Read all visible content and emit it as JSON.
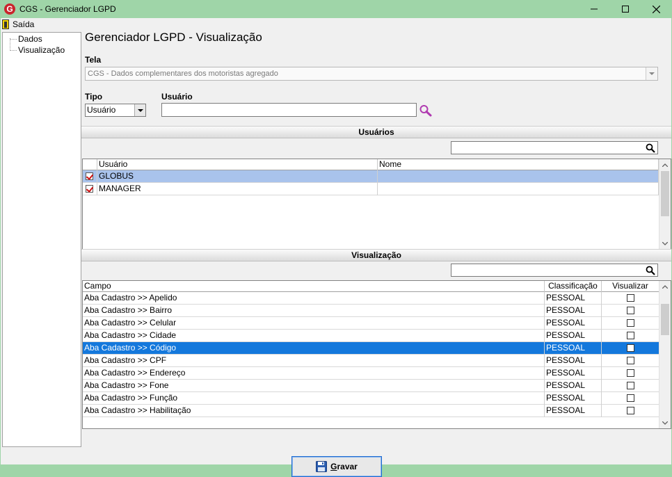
{
  "window": {
    "app_icon_letter": "G",
    "title": "CGS - Gerenciador LGPD"
  },
  "menu": {
    "exit_label": "Saída"
  },
  "tree": {
    "items": [
      {
        "label": "Dados"
      },
      {
        "label": "Visualização"
      }
    ]
  },
  "page": {
    "title": "Gerenciador LGPD - Visualização"
  },
  "form": {
    "tela_label": "Tela",
    "tela_value": "CGS - Dados complementares dos motoristas agregado",
    "tipo_label": "Tipo",
    "tipo_value": "Usuário",
    "usuario_label": "Usuário",
    "usuario_value": ""
  },
  "users_section": {
    "header": "Usuários",
    "filter_value": "",
    "columns": [
      "Usuário",
      "Nome"
    ],
    "rows": [
      {
        "checked": true,
        "usuario": "GLOBUS",
        "nome": ""
      },
      {
        "checked": true,
        "usuario": "MANAGER",
        "nome": ""
      }
    ]
  },
  "view_section": {
    "header": "Visualização",
    "filter_value": "",
    "columns": [
      "Campo",
      "Classificação",
      "Visualizar"
    ],
    "rows": [
      {
        "campo": "Aba Cadastro >> Apelido",
        "classificacao": "PESSOAL",
        "visualizar": false
      },
      {
        "campo": "Aba Cadastro >> Bairro",
        "classificacao": "PESSOAL",
        "visualizar": false
      },
      {
        "campo": "Aba Cadastro >> Celular",
        "classificacao": "PESSOAL",
        "visualizar": false
      },
      {
        "campo": "Aba Cadastro >> Cidade",
        "classificacao": "PESSOAL",
        "visualizar": false
      },
      {
        "campo": "Aba Cadastro >> Código",
        "classificacao": "PESSOAL",
        "visualizar": false
      },
      {
        "campo": "Aba Cadastro >> CPF",
        "classificacao": "PESSOAL",
        "visualizar": false
      },
      {
        "campo": "Aba Cadastro >> Endereço",
        "classificacao": "PESSOAL",
        "visualizar": false
      },
      {
        "campo": "Aba Cadastro >> Fone",
        "classificacao": "PESSOAL",
        "visualizar": false
      },
      {
        "campo": "Aba Cadastro >> Função",
        "classificacao": "PESSOAL",
        "visualizar": false
      },
      {
        "campo": "Aba Cadastro >> Habilitação",
        "classificacao": "PESSOAL",
        "visualizar": false
      }
    ]
  },
  "actions": {
    "save_prefix": "G",
    "save_rest": "ravar"
  },
  "colors": {
    "titlebar": "#9fd5a8",
    "selected_row_light": "#a9c3ec",
    "selected_row_dark": "#1478dc",
    "check_red": "#d01010",
    "search_magenta": "#b03ab0"
  },
  "icons": {
    "app": "cgs-logo-icon",
    "exit": "exit-door-icon",
    "search": "magnifier-icon",
    "save": "floppy-disk-icon"
  }
}
